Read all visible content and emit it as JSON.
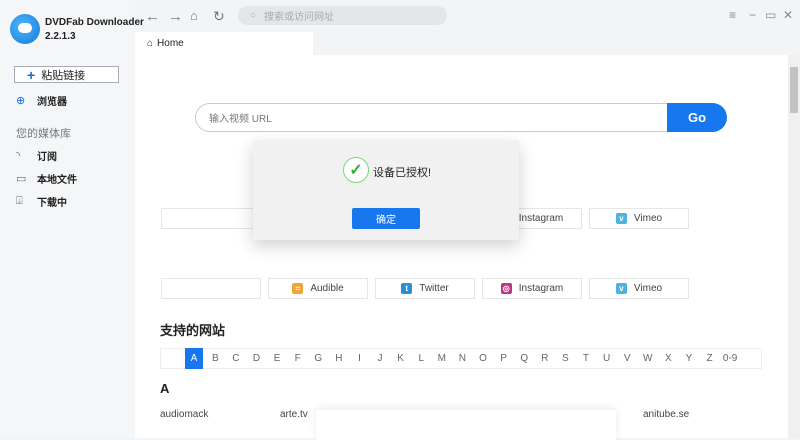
{
  "app": {
    "name": "DVDFab Downloader",
    "version": "2.2.1.3"
  },
  "sidebar": {
    "paste_label": "粘贴链接",
    "browser_label": "浏览器",
    "library_title": "您的媒体库",
    "items": [
      {
        "label": "订阅"
      },
      {
        "label": "本地文件"
      },
      {
        "label": "下载中"
      }
    ]
  },
  "toolbar": {
    "search_placeholder": "搜索或访问网址"
  },
  "tab": {
    "label": "Home"
  },
  "main": {
    "url_placeholder": "输入视频 URL",
    "go_label": "Go",
    "row1": [
      {
        "label": "Instagram",
        "icon": "instagram-icon",
        "color": "#c13584"
      },
      {
        "label": "Vimeo",
        "icon": "vimeo-icon",
        "color": "#4fb2de"
      }
    ],
    "row2": [
      {
        "label": "Audible",
        "icon": "audible-icon",
        "color": "#f0a53a"
      },
      {
        "label": "Twitter",
        "icon": "twitter-icon",
        "color": "#2b8fd6"
      },
      {
        "label": "Instagram",
        "icon": "instagram-icon",
        "color": "#c13584"
      },
      {
        "label": "Vimeo",
        "icon": "vimeo-icon",
        "color": "#4fb2de"
      }
    ],
    "supported_title": "支持的网站",
    "alphabet": [
      "A",
      "B",
      "C",
      "D",
      "E",
      "F",
      "G",
      "H",
      "I",
      "J",
      "K",
      "L",
      "M",
      "N",
      "O",
      "P",
      "Q",
      "R",
      "S",
      "T",
      "U",
      "V",
      "W",
      "X",
      "Y",
      "Z",
      "0-9"
    ],
    "section_letter": "A",
    "links": [
      "audiomack",
      "arte.tv",
      "anitube.se"
    ]
  },
  "dialog": {
    "message": "设备已授权!",
    "ok_label": "确定"
  },
  "colors": {
    "accent": "#1677ee"
  }
}
